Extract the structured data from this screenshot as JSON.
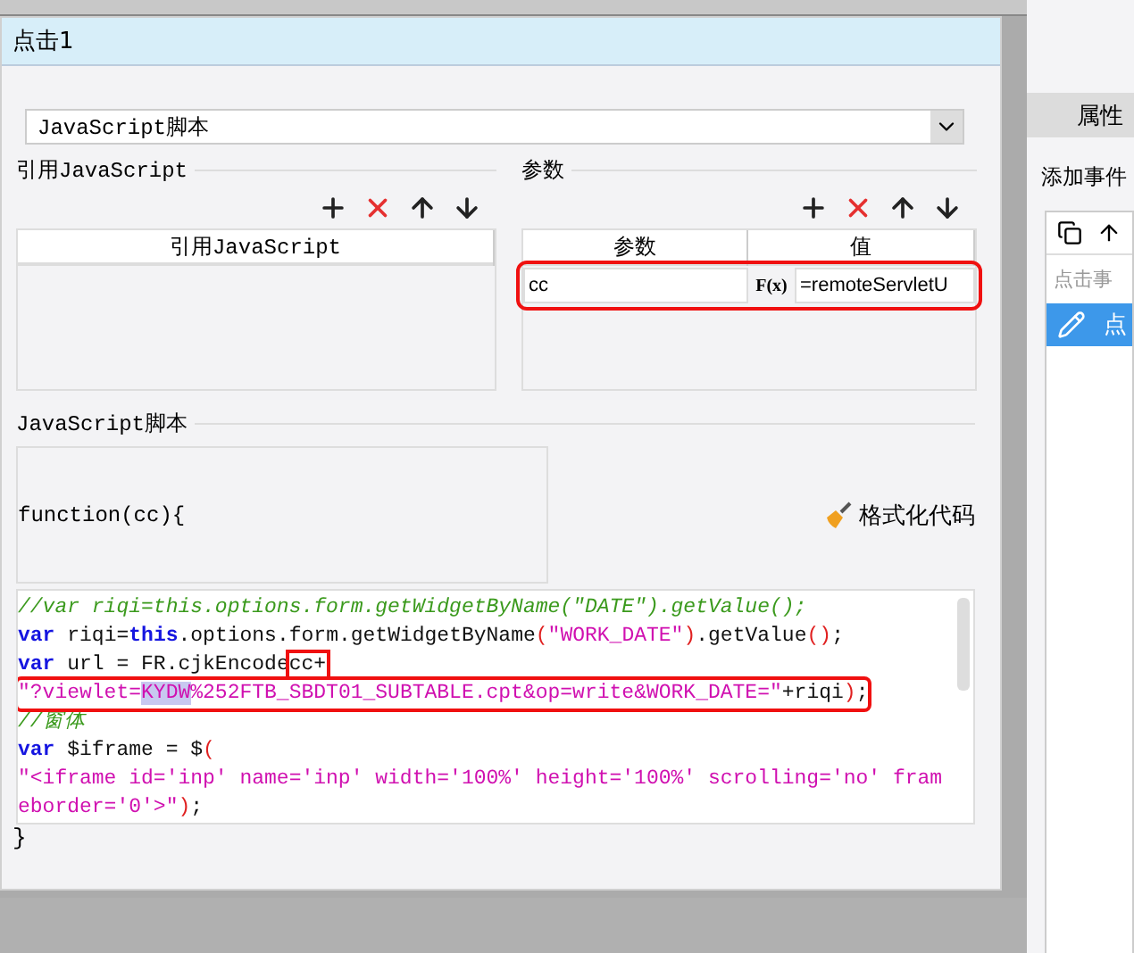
{
  "window": {
    "title": "点击1"
  },
  "action_type": {
    "value": "JavaScript脚本"
  },
  "references": {
    "label": "引用JavaScript",
    "columns": [
      "引用JavaScript"
    ]
  },
  "parameters": {
    "label": "参数",
    "columns": [
      "参数",
      "值"
    ],
    "rows": [
      {
        "name": "cc",
        "formula": "F(x)",
        "value": "=remoteServletU",
        "highlighted": true
      }
    ]
  },
  "script": {
    "label": "JavaScript脚本",
    "header": "function(cc){",
    "format_button": "格式化代码",
    "footer": "}",
    "lines": [
      {
        "boxed": false,
        "segments": [
          {
            "text": "//var riqi=this.options.form.getWidgetByName(\"DATE\").getValue();",
            "kind": "comment"
          }
        ]
      },
      {
        "boxed": false,
        "segments": [
          {
            "text": "var",
            "kind": "keyword"
          },
          {
            "text": " riqi=",
            "kind": "plain"
          },
          {
            "text": "this",
            "kind": "keyword"
          },
          {
            "text": ".options.form.getWidgetByName",
            "kind": "plain"
          },
          {
            "text": "(",
            "kind": "paren"
          },
          {
            "text": "\"WORK_DATE\"",
            "kind": "string"
          },
          {
            "text": ")",
            "kind": "paren"
          },
          {
            "text": ".getValue",
            "kind": "plain"
          },
          {
            "text": "()",
            "kind": "paren"
          },
          {
            "text": ";",
            "kind": "plain"
          }
        ]
      },
      {
        "boxed": false,
        "segments": [
          {
            "text": "var",
            "kind": "keyword"
          },
          {
            "text": " url = FR.cjkEncode",
            "kind": "plain"
          },
          {
            "text": "cc+",
            "kind": "plain",
            "boxed": true
          }
        ]
      },
      {
        "boxed": true,
        "segments": [
          {
            "text": "\"?viewlet=",
            "kind": "string"
          },
          {
            "text": "KYDW",
            "kind": "string",
            "selected": true
          },
          {
            "text": "%252FTB_SBDT01_SUBTABLE.cpt&op=write&WORK_DATE=\"",
            "kind": "string"
          },
          {
            "text": "+riqi",
            "kind": "plain"
          },
          {
            "text": ")",
            "kind": "paren"
          },
          {
            "text": ";",
            "kind": "plain"
          }
        ]
      },
      {
        "boxed": false,
        "segments": [
          {
            "text": "//窗体",
            "kind": "comment"
          }
        ]
      },
      {
        "boxed": false,
        "segments": [
          {
            "text": "var",
            "kind": "keyword"
          },
          {
            "text": " $iframe = $",
            "kind": "plain"
          },
          {
            "text": "(",
            "kind": "paren"
          }
        ]
      },
      {
        "boxed": false,
        "segments": [
          {
            "text": "\"<iframe id='inp' name='inp' width='100%' height='100%' scrolling='no' fram",
            "kind": "string"
          }
        ]
      },
      {
        "boxed": false,
        "segments": [
          {
            "text": "eborder='0'>\"",
            "kind": "string"
          },
          {
            "text": ")",
            "kind": "paren"
          },
          {
            "text": ";",
            "kind": "plain"
          }
        ]
      }
    ]
  },
  "side_panel": {
    "tab": "属性",
    "heading": "添加事件",
    "placeholder": "点击事",
    "items": [
      {
        "label": "点",
        "selected": true
      }
    ]
  }
}
